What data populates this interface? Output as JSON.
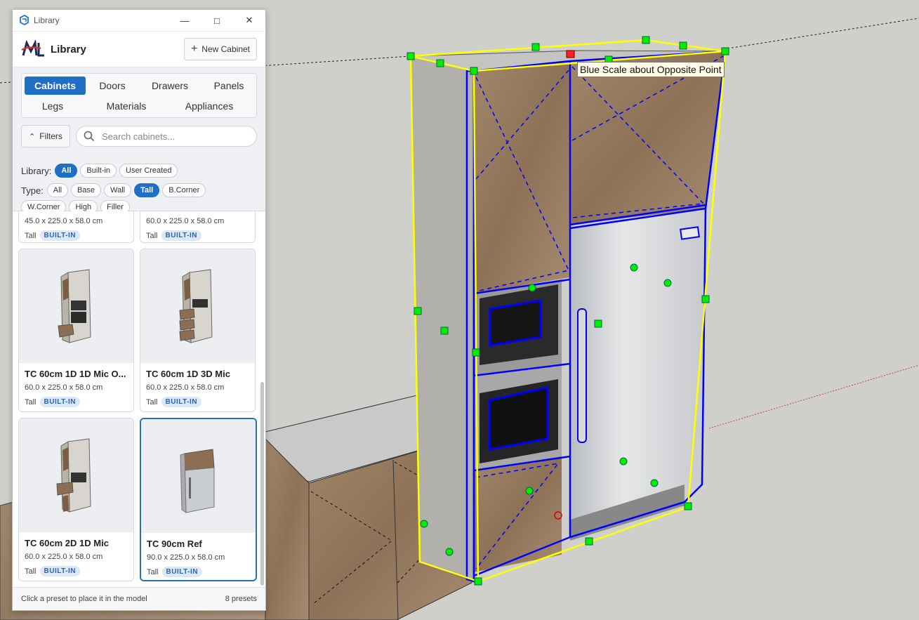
{
  "window": {
    "title": "Library"
  },
  "header": {
    "title": "Library",
    "new_button": "New Cabinet"
  },
  "tabs": [
    "Cabinets",
    "Doors",
    "Drawers",
    "Panels",
    "Legs",
    "Materials",
    "Appliances"
  ],
  "active_tab": "Cabinets",
  "filters": {
    "button_label": "Filters",
    "search_placeholder": "Search cabinets..."
  },
  "library_filter": {
    "label": "Library:",
    "options": [
      "All",
      "Built-in",
      "User Created"
    ],
    "selected": "All"
  },
  "type_filter": {
    "label": "Type:",
    "options": [
      "All",
      "Base",
      "Wall",
      "Tall",
      "B.Corner",
      "W.Corner",
      "High",
      "Filler"
    ],
    "selected": "Tall"
  },
  "cards": [
    {
      "name": "",
      "dims": "45.0 x 225.0 x 58.0 cm",
      "type": "Tall",
      "badge": "BUILT-IN"
    },
    {
      "name": "",
      "dims": "60.0 x 225.0 x 58.0 cm",
      "type": "Tall",
      "badge": "BUILT-IN"
    },
    {
      "name": "TC 60cm 1D 1D Mic O...",
      "dims": "60.0 x 225.0 x 58.0 cm",
      "type": "Tall",
      "badge": "BUILT-IN"
    },
    {
      "name": "TC 60cm 1D 3D Mic",
      "dims": "60.0 x 225.0 x 58.0 cm",
      "type": "Tall",
      "badge": "BUILT-IN"
    },
    {
      "name": "TC 60cm 2D 1D Mic",
      "dims": "60.0 x 225.0 x 58.0 cm",
      "type": "Tall",
      "badge": "BUILT-IN"
    },
    {
      "name": "TC 90cm Ref",
      "dims": "90.0 x 225.0 x 58.0 cm",
      "type": "Tall",
      "badge": "BUILT-IN"
    }
  ],
  "footer": {
    "hint": "Click a preset to place it in the model",
    "count": "8 presets"
  },
  "viewport": {
    "tooltip": "Blue Scale about Opposite Point"
  },
  "colors": {
    "accent": "#1f6fc7",
    "selection": "#0000ff",
    "bounding_box": "#ffff00",
    "grip": "#00ff00"
  }
}
